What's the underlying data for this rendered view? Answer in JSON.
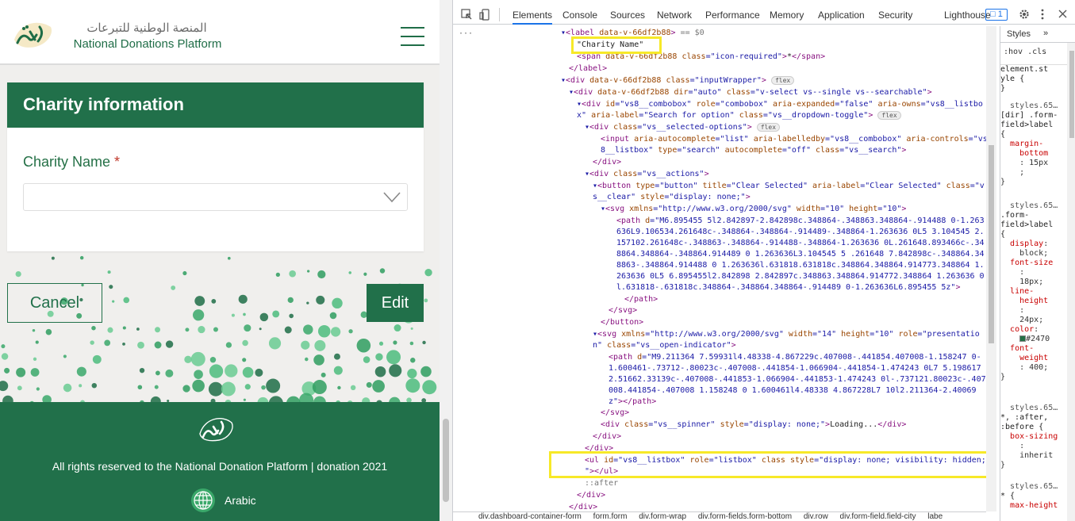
{
  "site": {
    "brand_ar": "المنصة الوطنية للتبرعات",
    "brand_en": "National Donations Platform",
    "logo_text": "تبرع",
    "card_title": "Charity information",
    "charity_label": "Charity Name",
    "required_mark": "*",
    "cancel_label": "Cancel",
    "edit_label": "Edit",
    "footer_text": "All rights reserved to the National Donation Platform | donation 2021",
    "language_label": "Arabic"
  },
  "colors": {
    "brand_green": "#21704a",
    "highlight": "#f7e928"
  },
  "devtools": {
    "tabs": [
      "Elements",
      "Console",
      "Sources",
      "Network",
      "Performance",
      "Memory",
      "Application",
      "Security",
      "Lighthouse"
    ],
    "issues_count": "1",
    "styles_tabs": [
      "Styles",
      "»"
    ],
    "styles_filter": [
      ":hov",
      ".cls"
    ],
    "breadcrumbs": [
      "div.dashboard-container-form",
      "form.form",
      "div.form-wrap",
      "div.form-fields.form-bottom",
      "div.row",
      "div.form-field.field-city",
      "labe"
    ],
    "icons": [
      "inspect-icon",
      "device-toolbar-icon",
      "settings-gear-icon",
      "more-vertical-icon",
      "close-icon"
    ]
  }
}
